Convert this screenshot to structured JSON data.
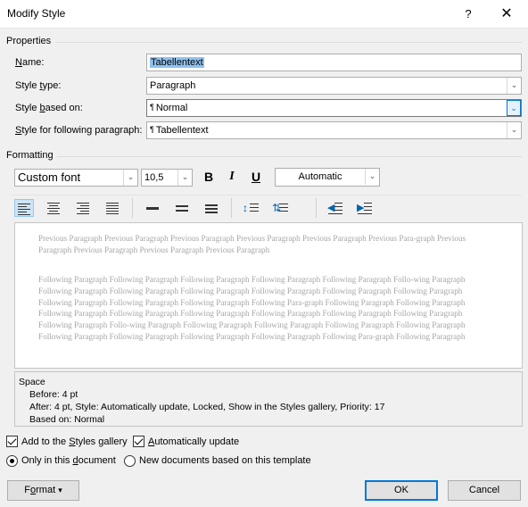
{
  "window": {
    "title": "Modify Style",
    "help": "?",
    "close": "✕"
  },
  "properties": {
    "section_label": "Properties",
    "name_label_prefix": "",
    "name_label_ul": "N",
    "name_label_rest": "ame:",
    "name_value": "Tabellentext",
    "style_type_label_a": "Style ",
    "style_type_label_ul": "t",
    "style_type_label_b": "ype:",
    "style_type_value": "Paragraph",
    "based_on_label_a": "Style ",
    "based_on_label_ul": "b",
    "based_on_label_b": "ased on:",
    "based_on_value": "Normal",
    "following_label_ul": "S",
    "following_label_rest": "tyle for following paragraph:",
    "following_value": "Tabellentext",
    "pilcrow": "¶"
  },
  "formatting": {
    "section_label": "Formatting",
    "font": "Custom font",
    "size": "10,5",
    "bold": "B",
    "italic": "I",
    "underline": "U",
    "color": "Automatic",
    "dropdown_arrow": "⌵"
  },
  "preview": {
    "previous_text": "Previous Paragraph Previous Paragraph Previous Paragraph Previous Paragraph Previous Paragraph Previous Para-graph Previous Paragraph Previous Paragraph Previous Paragraph Previous Paragraph",
    "following_text": "Following Paragraph Following Paragraph Following Paragraph Following Paragraph Following Paragraph Follo-wing Paragraph Following Paragraph Following Paragraph Following Paragraph Following Paragraph Following Paragraph Following Paragraph Following Paragraph Following Paragraph Following Paragraph Following Para-graph Following Paragraph Following Paragraph Following Paragraph Following Paragraph Following Paragraph Following Paragraph Following Paragraph Following Paragraph Following Paragraph Follo-wing Paragraph Following Paragraph Following Paragraph Following Paragraph Following Paragraph Following Paragraph Following Paragraph Following Paragraph Following Paragraph Following Para-graph Following Paragraph"
  },
  "description": {
    "heading": "Space",
    "before": "Before:  4 pt",
    "after": "After:  4 pt, Style: Automatically update, Locked, Show in the Styles gallery, Priority: 17",
    "based": "Based on: Normal"
  },
  "options": {
    "add_gallery_a": "Add to the ",
    "add_gallery_ul": "S",
    "add_gallery_b": "tyles gallery",
    "auto_update_ul": "A",
    "auto_update_rest": "utomatically update",
    "only_doc_a": "Only in this ",
    "only_doc_ul": "d",
    "only_doc_b": "ocument",
    "new_docs": "New documents based on this template"
  },
  "buttons": {
    "format_a": "F",
    "format_ul": "o",
    "format_b": "rmat",
    "format_arrow": "▾",
    "ok": "OK",
    "cancel": "Cancel"
  }
}
